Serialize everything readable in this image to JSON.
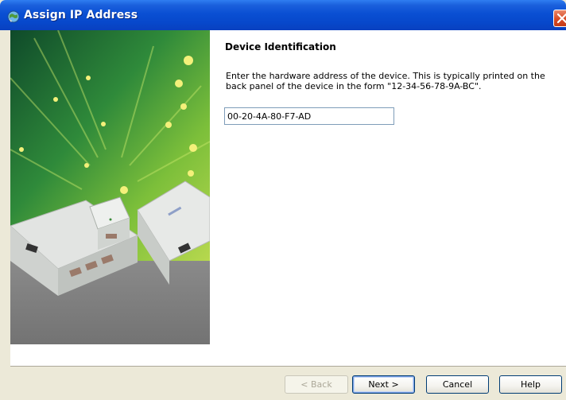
{
  "window": {
    "title": "Assign IP Address"
  },
  "page": {
    "section_title": "Device Identification",
    "description": "Enter the hardware address of the device.  This is typically printed on the back panel of the device in the form \"12-34-56-78-9A-BC\".",
    "hardware_address": {
      "value": "00-20-4A-80-F7-AD",
      "placeholder": ""
    }
  },
  "buttons": {
    "back": "< Back",
    "next": "Next >",
    "cancel": "Cancel",
    "help": "Help"
  },
  "colors": {
    "titlebar": "#0a4fd3",
    "dialog_face": "#ece9d8",
    "close_button": "#d84b25"
  },
  "icons": {
    "title": "network-globe-icon",
    "close": "close-icon"
  }
}
